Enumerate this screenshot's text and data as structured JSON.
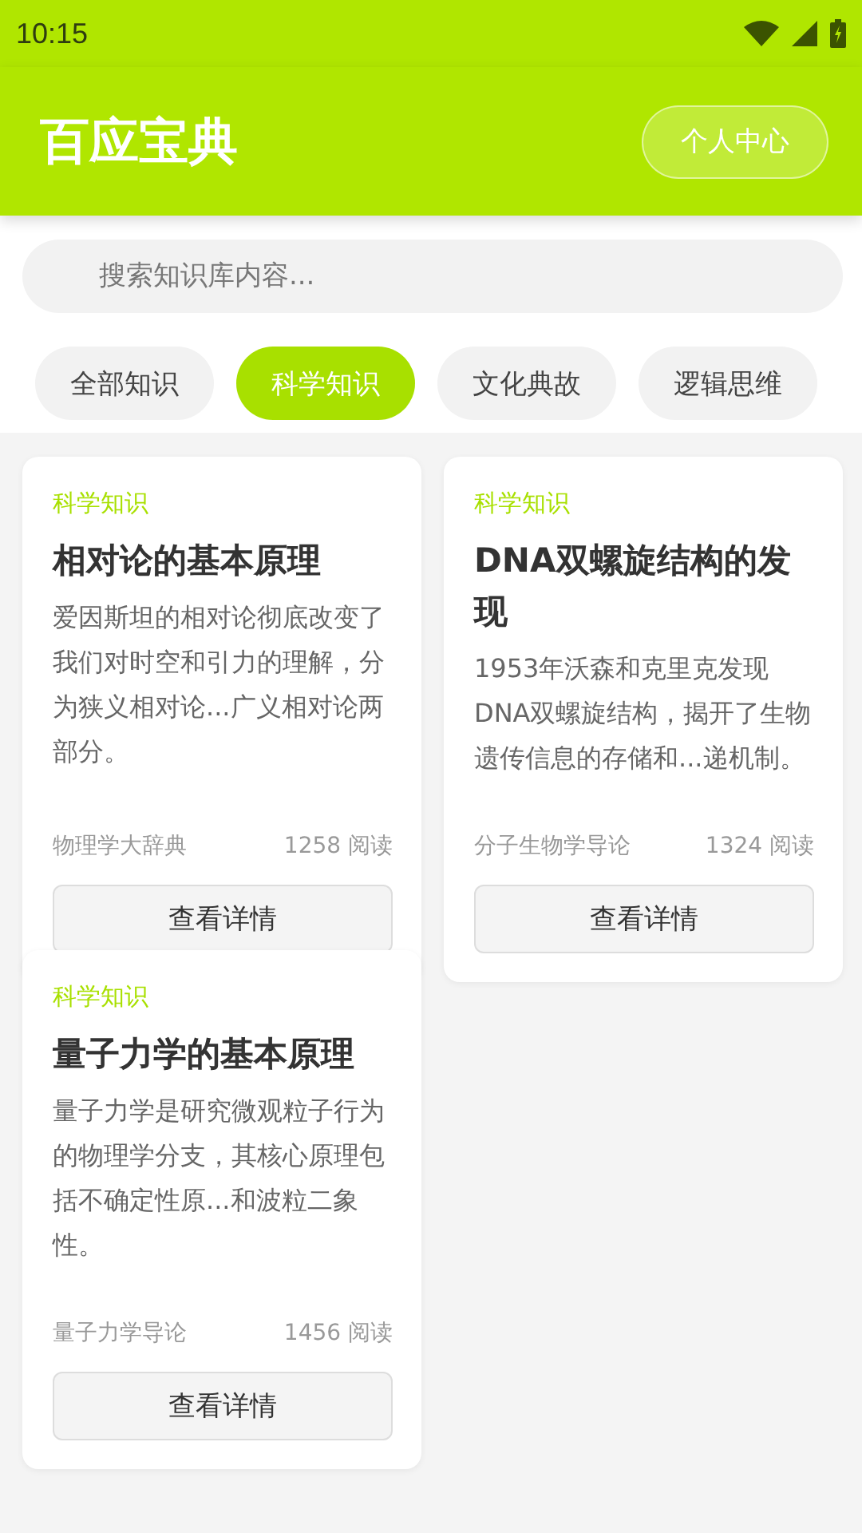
{
  "status_bar": {
    "time": "10:15"
  },
  "app_bar": {
    "title": "百应宝典",
    "profile_button": "个人中心"
  },
  "search": {
    "placeholder": "搜索知识库内容..."
  },
  "tabs": [
    {
      "label": "全部知识",
      "selected": false
    },
    {
      "label": "科学知识",
      "selected": true
    },
    {
      "label": "文化典故",
      "selected": false
    },
    {
      "label": "逻辑思维",
      "selected": false
    }
  ],
  "cards": [
    {
      "category": "科学知识",
      "title": "相对论的基本原理",
      "summary": "爱因斯坦的相对论彻底改变了我们对时空和引力的理解，分为狭义相对论...广义相对论两部分。",
      "source": "物理学大辞典",
      "reads": "1258 阅读",
      "button": "查看详情"
    },
    {
      "category": "科学知识",
      "title": "DNA双螺旋结构的发现",
      "summary": "1953年沃森和克里克发现DNA双螺旋结构，揭开了生物遗传信息的存储和...递机制。",
      "source": "分子生物学导论",
      "reads": "1324 阅读",
      "button": "查看详情"
    },
    {
      "category": "科学知识",
      "title": "量子力学的基本原理",
      "summary": "量子力学是研究微观粒子行为的物理学分支，其核心原理包括不确定性原...和波粒二象性。",
      "source": "量子力学导论",
      "reads": "1456 阅读",
      "button": "查看详情"
    }
  ]
}
